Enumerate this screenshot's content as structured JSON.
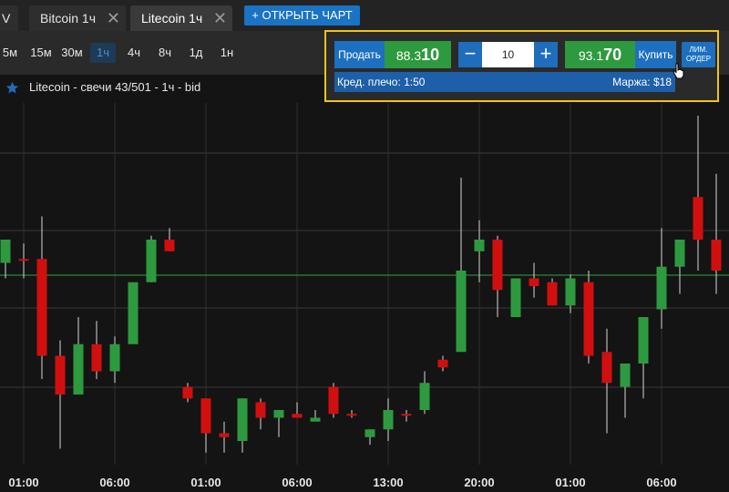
{
  "tabs": [
    {
      "label": "V",
      "active": false,
      "closable": false
    },
    {
      "label": "Bitcoin 1ч",
      "active": false,
      "closable": true
    },
    {
      "label": "Litecoin 1ч",
      "active": true,
      "closable": true
    }
  ],
  "open_chart_label": "+ ОТКРЫТЬ ЧАРТ",
  "timeframes": [
    {
      "label": "5м",
      "active": false
    },
    {
      "label": "15м",
      "active": false
    },
    {
      "label": "30м",
      "active": false
    },
    {
      "label": "1ч",
      "active": true
    },
    {
      "label": "4ч",
      "active": false
    },
    {
      "label": "8ч",
      "active": false
    },
    {
      "label": "1д",
      "active": false
    },
    {
      "label": "1н",
      "active": false
    }
  ],
  "trade": {
    "sell_label": "Продать",
    "sell_price_small": "88.3",
    "sell_price_big": "10",
    "quantity": "10",
    "buy_price_small": "93.1",
    "buy_price_big": "70",
    "buy_label": "Купить",
    "limit_line1": "ЛИМ.",
    "limit_line2": "ОРДЕР",
    "leverage": "Кред. плечо: 1:50",
    "margin": "Маржа: $18"
  },
  "chart_title": "Litecoin - свечи 43/501 - 1ч - bid",
  "colors": {
    "up": "#2e9a3f",
    "down": "#d10f0f",
    "accent": "#1d6fc0",
    "highlight": "#f0c419",
    "current_price_line": "#2f9e44"
  },
  "chart_data": {
    "type": "candlestick",
    "x_tick_labels": [
      "01:00",
      "06:00",
      "01:00",
      "06:00",
      "13:00",
      "20:00",
      "01:00",
      "06:00"
    ],
    "candles": [
      {
        "o": 0.3,
        "h": 0.2,
        "l": 0.5,
        "c": 0.0
      },
      {
        "o": 0.25,
        "h": 0.05,
        "l": 0.5,
        "c": 0.25
      },
      {
        "o": 0.25,
        "h": -0.3,
        "l": 1.8,
        "c": 1.5
      },
      {
        "o": 1.5,
        "h": 1.3,
        "l": 2.7,
        "c": 2.0
      },
      {
        "o": 2.0,
        "h": 1.0,
        "l": 2.0,
        "c": 1.35
      },
      {
        "o": 1.35,
        "h": 1.05,
        "l": 1.8,
        "c": 1.7
      },
      {
        "o": 1.7,
        "h": 1.25,
        "l": 1.85,
        "c": 1.35
      },
      {
        "o": 1.35,
        "h": 0.9,
        "l": 1.35,
        "c": 0.55
      },
      {
        "o": 0.55,
        "h": -0.05,
        "l": 0.55,
        "c": 0.0
      },
      {
        "o": 0.0,
        "h": -0.15,
        "l": 0.15,
        "c": 0.15
      },
      {
        "o": 1.9,
        "h": 1.85,
        "l": 2.1,
        "c": 2.05
      },
      {
        "o": 2.05,
        "h": 2.05,
        "l": 2.75,
        "c": 2.5
      },
      {
        "o": 2.5,
        "h": 2.35,
        "l": 2.75,
        "c": 2.55
      },
      {
        "o": 2.6,
        "h": 2.05,
        "l": 2.75,
        "c": 2.05
      },
      {
        "o": 2.1,
        "h": 2.05,
        "l": 2.45,
        "c": 2.3
      },
      {
        "o": 2.3,
        "h": 2.2,
        "l": 2.55,
        "c": 2.2
      },
      {
        "o": 2.25,
        "h": 2.1,
        "l": 2.3,
        "c": 2.3
      },
      {
        "o": 2.35,
        "h": 2.2,
        "l": 2.3,
        "c": 2.3
      },
      {
        "o": 1.9,
        "h": 1.85,
        "l": 2.3,
        "c": 2.25
      },
      {
        "o": 2.25,
        "h": 2.2,
        "l": 2.3,
        "c": 2.25
      },
      {
        "o": 2.55,
        "h": 2.45,
        "l": 2.65,
        "c": 2.45
      },
      {
        "o": 2.45,
        "h": 2.05,
        "l": 2.6,
        "c": 2.2
      },
      {
        "o": 2.25,
        "h": 2.2,
        "l": 2.35,
        "c": 2.25
      },
      {
        "o": 2.2,
        "h": 1.7,
        "l": 2.25,
        "c": 1.85
      },
      {
        "o": 1.55,
        "h": 1.5,
        "l": 1.7,
        "c": 1.65
      },
      {
        "o": 1.45,
        "h": -0.8,
        "l": 1.45,
        "c": 0.4
      },
      {
        "o": 0.15,
        "h": -0.25,
        "l": 0.55,
        "c": 0.0
      },
      {
        "o": 0.0,
        "h": -0.05,
        "l": 1.0,
        "c": 0.65
      },
      {
        "o": 1.0,
        "h": 0.6,
        "l": 1.0,
        "c": 0.5
      },
      {
        "o": 0.5,
        "h": 0.3,
        "l": 0.75,
        "c": 0.6
      },
      {
        "o": 0.55,
        "h": 0.5,
        "l": 0.85,
        "c": 0.85
      },
      {
        "o": 0.85,
        "h": 0.45,
        "l": 0.95,
        "c": 0.5
      },
      {
        "o": 0.55,
        "h": 0.4,
        "l": 1.6,
        "c": 1.5
      },
      {
        "o": 1.45,
        "h": 1.15,
        "l": 2.5,
        "c": 1.85
      },
      {
        "o": 1.9,
        "h": 1.7,
        "l": 2.3,
        "c": 1.6
      },
      {
        "o": 1.6,
        "h": 1.25,
        "l": 2.05,
        "c": 1.0
      },
      {
        "o": 0.9,
        "h": -0.15,
        "l": 1.15,
        "c": 0.35
      },
      {
        "o": 0.35,
        "h": 0.0,
        "l": 0.7,
        "c": 0.0
      },
      {
        "o": -0.55,
        "h": -1.6,
        "l": 0.4,
        "c": 0.0
      },
      {
        "o": 0.0,
        "h": -0.85,
        "l": 0.7,
        "c": 0.4
      }
    ]
  }
}
